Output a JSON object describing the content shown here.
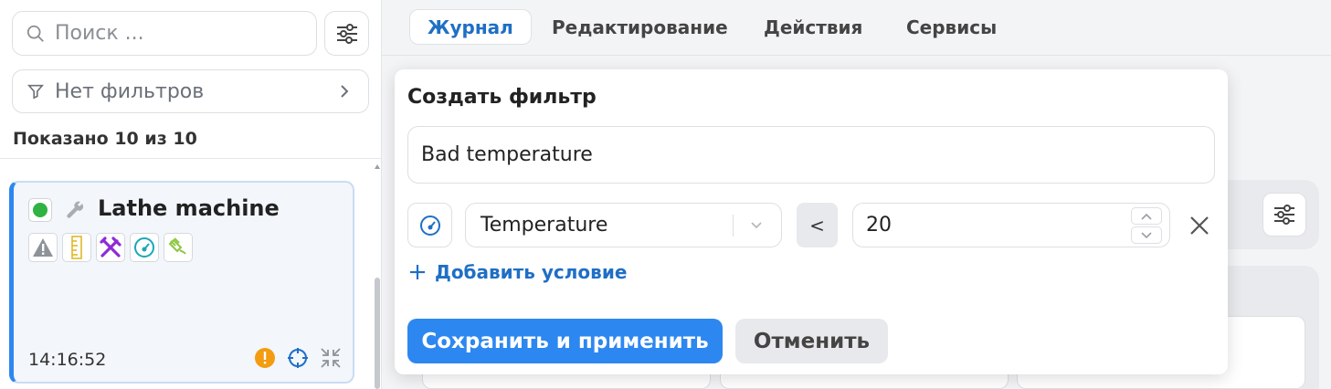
{
  "sidebar": {
    "search": {
      "placeholder": "Поиск ..."
    },
    "filters_label": "Нет фильтров",
    "shown_count": "Показано 10 из 10",
    "machine_card": {
      "title": "Lathe machine",
      "status_color": "#2fb344",
      "time": "14:16:52",
      "badges": [
        "warning-icon",
        "ruler-icon",
        "tools-icon",
        "gauge-icon",
        "plug-icon"
      ]
    }
  },
  "tabs": [
    {
      "label": "Журнал",
      "active": true
    },
    {
      "label": "Редактирование"
    },
    {
      "label": "Действия"
    },
    {
      "label": "Сервисы"
    }
  ],
  "filter_popover": {
    "title": "Создать фильтр",
    "name_value": "Bad temperature",
    "condition": {
      "field": "Temperature",
      "operator": "<",
      "value": "20"
    },
    "add_condition_label": "Добавить условие",
    "save_label": "Сохранить и применить",
    "cancel_label": "Отменить"
  },
  "colors": {
    "accent": "#2d87f0",
    "link": "#1f6fc5"
  }
}
